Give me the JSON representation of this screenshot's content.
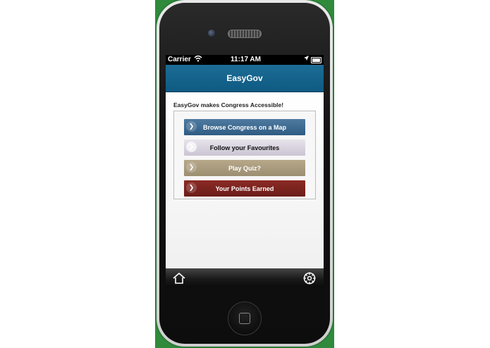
{
  "status_bar": {
    "carrier": "Carrier",
    "time": "11:17 AM"
  },
  "nav": {
    "title": "EasyGov"
  },
  "content": {
    "intro": "EasyGov makes Congress Accessible!",
    "menu": [
      {
        "label": "Browse Congress on a Map",
        "color": "#3f6b92"
      },
      {
        "label": "Follow your Favourites",
        "color": "#d9d3df"
      },
      {
        "label": "Play Quiz?",
        "color": "#a99b7e"
      },
      {
        "label": "Your Points Earned",
        "color": "#7c231f"
      }
    ]
  },
  "tab_bar": {
    "icons": [
      "home-icon",
      "settings-icon"
    ]
  },
  "colors": {
    "nav_bar": "#0e5a82",
    "background_green": "#2f8a3c"
  }
}
